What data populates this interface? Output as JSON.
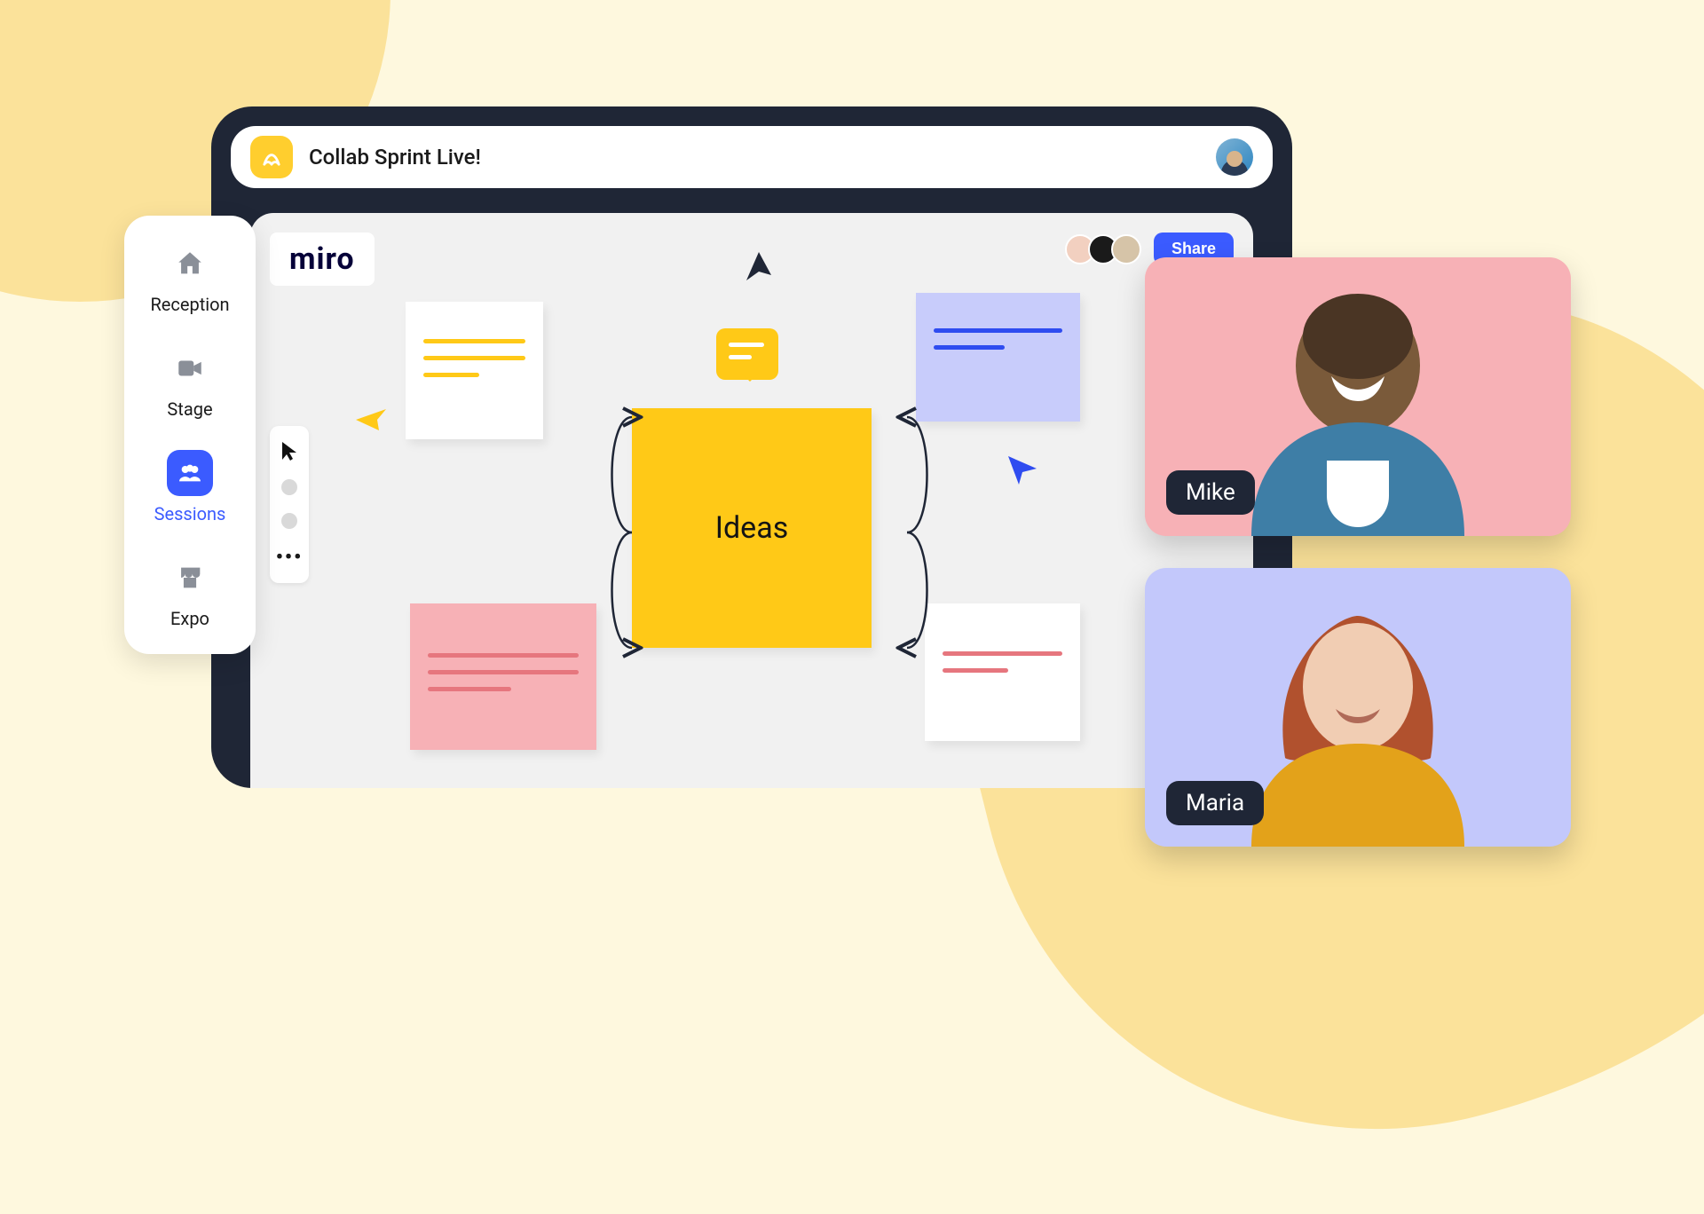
{
  "header": {
    "session_title": "Collab Sprint Live!"
  },
  "sidebar": {
    "items": [
      {
        "label": "Reception"
      },
      {
        "label": "Stage"
      },
      {
        "label": "Sessions"
      },
      {
        "label": "Expo"
      }
    ],
    "active_index": 2
  },
  "board": {
    "app_name": "miro",
    "share_label": "Share",
    "center_note": "Ideas"
  },
  "participants": [
    {
      "name": "Mike"
    },
    {
      "name": "Maria"
    }
  ]
}
